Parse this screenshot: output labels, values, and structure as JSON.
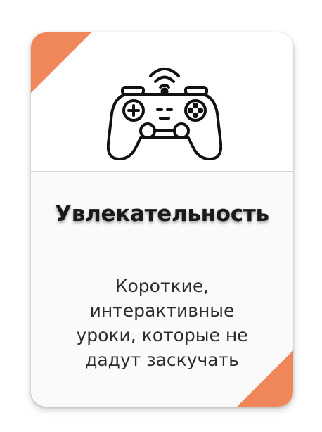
{
  "card": {
    "title": "Увлекательность",
    "description": "Короткие,\nинтерактивные\nуроки, которые не\nдадут заскучать",
    "icon": "gamepad-wireless-icon"
  },
  "colors": {
    "accent": "#f0875a",
    "text": "#1a1a1a",
    "divider": "#d6d6d6"
  }
}
